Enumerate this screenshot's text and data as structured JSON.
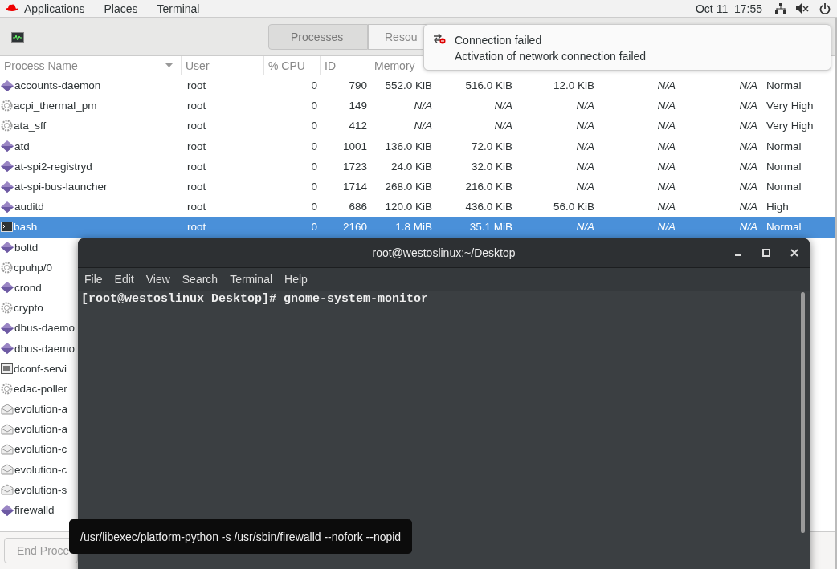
{
  "top_bar": {
    "menus": [
      "Applications",
      "Places",
      "Terminal"
    ],
    "clock": "Oct 11  17:55"
  },
  "tabs": [
    {
      "label": "Processes",
      "selected": true
    },
    {
      "label": "Resou",
      "selected": false
    }
  ],
  "notification": {
    "title": "Connection failed",
    "body": "Activation of network connection failed"
  },
  "table": {
    "columns": [
      "Process Name",
      "User",
      "% CPU",
      "ID",
      "Memory"
    ],
    "rows": [
      {
        "kind": "service",
        "name": "accounts-daemon",
        "user": "root",
        "cpu": "0",
        "id": "790",
        "memory": "552.0 KiB",
        "column_6": "516.0 KiB",
        "column_7": "12.0 KiB",
        "column_8": "N/A",
        "column_9": "N/A",
        "priority": "Normal",
        "selected": false
      },
      {
        "kind": "kernel",
        "name": "acpi_thermal_pm",
        "user": "root",
        "cpu": "0",
        "id": "149",
        "memory": "N/A",
        "column_6": "N/A",
        "column_7": "N/A",
        "column_8": "N/A",
        "column_9": "N/A",
        "priority": "Very High",
        "selected": false
      },
      {
        "kind": "kernel",
        "name": "ata_sff",
        "user": "root",
        "cpu": "0",
        "id": "412",
        "memory": "N/A",
        "column_6": "N/A",
        "column_7": "N/A",
        "column_8": "N/A",
        "column_9": "N/A",
        "priority": "Very High",
        "selected": false
      },
      {
        "kind": "service",
        "name": "atd",
        "user": "root",
        "cpu": "0",
        "id": "1001",
        "memory": "136.0 KiB",
        "column_6": "72.0 KiB",
        "column_7": "N/A",
        "column_8": "N/A",
        "column_9": "N/A",
        "priority": "Normal",
        "selected": false
      },
      {
        "kind": "service",
        "name": "at-spi2-registryd",
        "user": "root",
        "cpu": "0",
        "id": "1723",
        "memory": "24.0 KiB",
        "column_6": "32.0 KiB",
        "column_7": "N/A",
        "column_8": "N/A",
        "column_9": "N/A",
        "priority": "Normal",
        "selected": false
      },
      {
        "kind": "service",
        "name": "at-spi-bus-launcher",
        "user": "root",
        "cpu": "0",
        "id": "1714",
        "memory": "268.0 KiB",
        "column_6": "216.0 KiB",
        "column_7": "N/A",
        "column_8": "N/A",
        "column_9": "N/A",
        "priority": "Normal",
        "selected": false
      },
      {
        "kind": "service",
        "name": "auditd",
        "user": "root",
        "cpu": "0",
        "id": "686",
        "memory": "120.0 KiB",
        "column_6": "436.0 KiB",
        "column_7": "56.0 KiB",
        "column_8": "N/A",
        "column_9": "N/A",
        "priority": "High",
        "selected": false
      },
      {
        "kind": "terminal",
        "name": "bash",
        "user": "root",
        "cpu": "0",
        "id": "2160",
        "memory": "1.8 MiB",
        "column_6": "35.1 MiB",
        "column_7": "N/A",
        "column_8": "N/A",
        "column_9": "N/A",
        "priority": "Normal",
        "selected": true
      },
      {
        "kind": "service",
        "name": "boltd",
        "selected": false
      },
      {
        "kind": "kernel",
        "name": "cpuhp/0",
        "selected": false
      },
      {
        "kind": "service",
        "name": "crond",
        "selected": false
      },
      {
        "kind": "kernel",
        "name": "crypto",
        "selected": false
      },
      {
        "kind": "service",
        "name": "dbus-daemo",
        "selected": false
      },
      {
        "kind": "service",
        "name": "dbus-daemo",
        "selected": false
      },
      {
        "kind": "settings",
        "name": "dconf-servi",
        "selected": false
      },
      {
        "kind": "kernel",
        "name": "edac-poller",
        "selected": false
      },
      {
        "kind": "mail",
        "name": "evolution-a",
        "selected": false
      },
      {
        "kind": "mail",
        "name": "evolution-a",
        "selected": false
      },
      {
        "kind": "mail",
        "name": "evolution-c",
        "selected": false
      },
      {
        "kind": "mail",
        "name": "evolution-c",
        "selected": false
      },
      {
        "kind": "mail",
        "name": "evolution-s",
        "selected": false
      },
      {
        "kind": "service",
        "name": "firewalld",
        "selected": false
      }
    ]
  },
  "end_process_button": "End Proce",
  "terminal": {
    "title": "root@westoslinux:~/Desktop",
    "menus": [
      "File",
      "Edit",
      "View",
      "Search",
      "Terminal",
      "Help"
    ],
    "command_line": "[root@westoslinux Desktop]# gnome-system-monitor"
  },
  "tooltip": "/usr/libexec/platform-python -s /usr/sbin/firewalld --nofork --nopid"
}
